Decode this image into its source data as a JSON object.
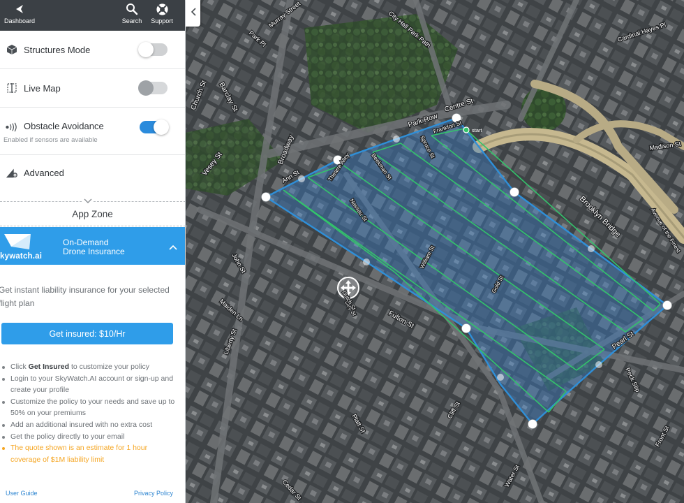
{
  "topbar": {
    "dashboard_label": "Dashboard",
    "search_label": "Search",
    "support_label": "Support"
  },
  "settings": {
    "structures_mode": {
      "label": "Structures Mode",
      "enabled": false
    },
    "live_map": {
      "label": "Live Map",
      "enabled": false,
      "disabled": true
    },
    "obstacle_avoidance": {
      "label": "Obstacle Avoidance",
      "sublabel": "Enabled if sensors are available",
      "enabled": true
    },
    "advanced": {
      "label": "Advanced"
    }
  },
  "app_zone": {
    "label": "App Zone"
  },
  "skywatch": {
    "brand": "kywatch.ai",
    "title_line1": "On-Demand",
    "title_line2": "Drone Insurance",
    "description": "Get instant liability insurance for your selected flight plan",
    "button_label": "Get insured: $10/Hr",
    "bullets": [
      {
        "pre": "Click ",
        "bold": "Get Insured",
        "post": " to customize your policy"
      },
      {
        "text": "Login to your SkyWatch.AI account or sign-up and create your profile"
      },
      {
        "text": "Customize the policy to your needs and save up to 50% on your premiums"
      },
      {
        "text": "Add an additional insured with no extra cost"
      },
      {
        "text": "Get the policy directly to your email"
      },
      {
        "text": "The quote shown is an estimate for 1 hour coverage of $1M liability limit",
        "warn": true
      }
    ]
  },
  "footer": {
    "user_guide": "User Guide",
    "privacy_policy": "Privacy Policy"
  },
  "map": {
    "start_label": "start",
    "colors": {
      "boundary": "#2f8fd8",
      "path": "#33c46b",
      "fill": "#3a7fc9",
      "vertex": "#ffffff"
    },
    "street_labels": [
      "Park Row",
      "Centre St",
      "Frankfort St",
      "Spruce St",
      "Beekman St",
      "Theatre Alley",
      "Nassau St",
      "Ann St",
      "William St",
      "Gold St",
      "Fulton St",
      "Pearl St",
      "Brooklyn Bridge",
      "Vesey St",
      "Barclay St",
      "Park Pl",
      "Church St",
      "Broadway",
      "John St",
      "Maiden Ln",
      "Liberty St",
      "Dey St",
      "Cliff St",
      "Platt St",
      "Water St",
      "Peck Slip",
      "Front St",
      "Madison St",
      "City Hall Park Path",
      "Cardinal Hayes Pl",
      "Avenue of the Finest",
      "Murray Street",
      "Cedar St",
      "Dutch St"
    ]
  }
}
